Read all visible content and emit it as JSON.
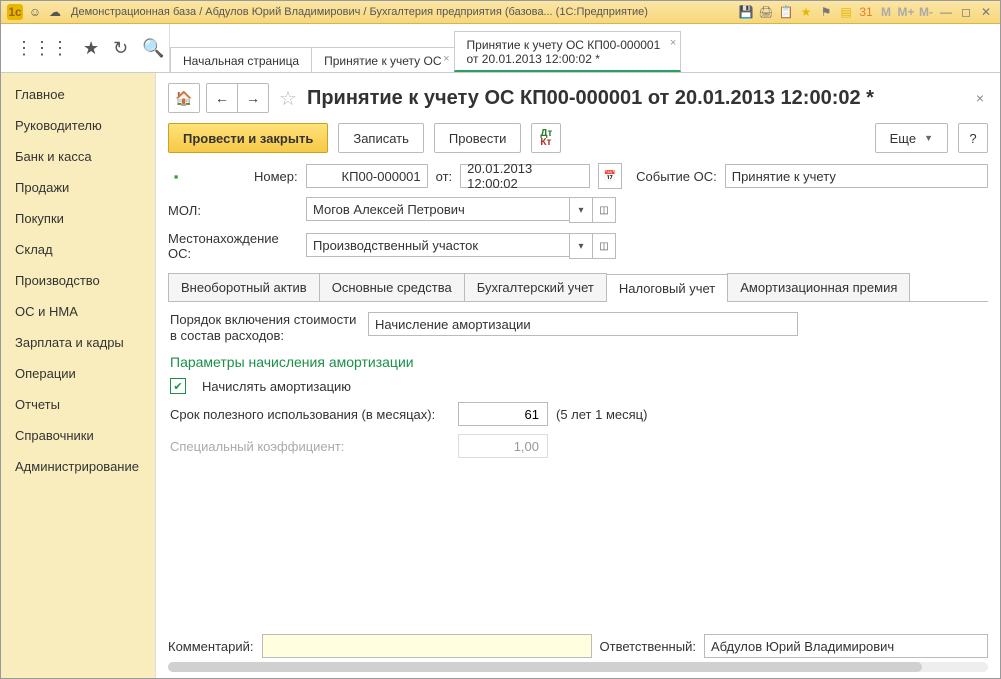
{
  "titlebar": {
    "text": "Демонстрационная база / Абдулов Юрий Владимирович / Бухгалтерия предприятия (базова...  (1С:Предприятие)",
    "memory": {
      "m": "M",
      "mplus": "M+",
      "mminus": "M-"
    }
  },
  "top_tabs": {
    "start": "Начальная страница",
    "tab1": "Принятие к учету ОС",
    "tab2_line1": "Принятие к учету ОС КП00-000001",
    "tab2_line2": "от 20.01.2013 12:00:02 *"
  },
  "sidebar": {
    "items": [
      "Главное",
      "Руководителю",
      "Банк и касса",
      "Продажи",
      "Покупки",
      "Склад",
      "Производство",
      "ОС и НМА",
      "Зарплата и кадры",
      "Операции",
      "Отчеты",
      "Справочники",
      "Администрирование"
    ]
  },
  "page": {
    "title": "Принятие к учету ОС КП00-000001 от 20.01.2013 12:00:02 *"
  },
  "cmdbar": {
    "post_close": "Провести и закрыть",
    "save": "Записать",
    "post": "Провести",
    "more": "Еще",
    "help": "?"
  },
  "header": {
    "number_label": "Номер:",
    "number": "КП00-000001",
    "from_label": "от:",
    "date": "20.01.2013 12:00:02",
    "event_label": "Событие ОС:",
    "event": "Принятие к учету",
    "mol_label": "МОЛ:",
    "mol": "Могов Алексей Петрович",
    "location_label": "Местонахождение ОС:",
    "location": "Производственный участок"
  },
  "tabs": {
    "t1": "Внеоборотный актив",
    "t2": "Основные средства",
    "t3": "Бухгалтерский учет",
    "t4": "Налоговый учет",
    "t5": "Амортизационная премия"
  },
  "tax": {
    "cost_label": "Порядок включения стоимости в состав расходов:",
    "cost_value": "Начисление амортизации",
    "section": "Параметры начисления амортизации",
    "charge_label": "Начислять амортизацию",
    "life_label": "Срок полезного использования (в месяцах):",
    "life_value": "61",
    "life_hint": "(5 лет 1 месяц)",
    "coeff_label": "Специальный коэффициент:",
    "coeff_value": "1,00"
  },
  "footer": {
    "comment_label": "Комментарий:",
    "comment": "",
    "resp_label": "Ответственный:",
    "resp": "Абдулов Юрий Владимирович"
  }
}
